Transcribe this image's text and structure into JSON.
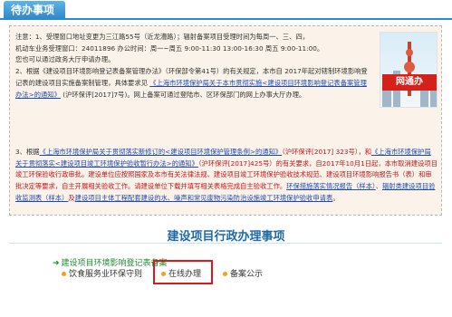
{
  "header": {
    "tab_label": "待办事项"
  },
  "notice": {
    "p1_a": "注意：1、受理窗口地址变更为三江路55号（近龙漕路）；辐射备案项目受理时间为每周一、三、四，",
    "p1_b": "机动车业务受理窗口：24011896 办公时间：周一~周五 9:00-11:30 13:00-16:30 周五 9:00-11:00。",
    "p1_c": "您也可以通过政务大厅申请办理。",
    "p2_a": "2、根据《建设项目环境影响登记表备案管理办法》（环保部令第41号）的有关规定，本市自",
    "p2_b": "2017年起对辖制环境影响登记表的建设项目实施备案制管理，具体要求见",
    "p2_link1": "《上海市环境保护局关于本市贯彻实施<建设项目环境影响登记表备案管理办法>的通知》",
    "p2_c": "(沪环保评[2017]7号)。网上备案可通过登陆市、区环保部门的网上办事大厅办理。",
    "p3_prefix": "3、根据",
    "p3_link1": "《上海市环境保护局关于贯彻落实新修订的<建设项目环境保护管理条例>的通知》",
    "p3_a": "（沪环保评",
    "p3_b": "[2017] 323号）",
    "p3_and": "，和",
    "p3_link2": "《上海市环境保护局关于贯彻落实<建设项目竣工环境保护验收暂行办法>的通知》",
    "p3_c": "（沪环保评[2017]425号）",
    "p3_d": "的有关要求，自2017年10月1日起，本市取消建设项目竣工环保验收行政审批。建设单位应按照国家及本市有关法律法规、建设项目竣工环境保护验收技术规范、建设项目环境影响报告书（表）和审批决定等要求，自主开展相关验收工作。请建设单位下载并填写相关表格完成自主验收工作。",
    "p3_link3": "环保措施落实情况报告（样本）",
    "p3_e": "、",
    "p3_link4": "辐射类建设项目验收监测表（样本）",
    "p3_f": "及",
    "p3_link5": "建设项目主体工程配套建设的水、噪声和常见废物污染防治设施竣工环境保护验收申请表",
    "p3_g": "。"
  },
  "side_image": {
    "label": "网通办"
  },
  "section": {
    "title": "建设项目行政办理事项",
    "category": "建设项目环境影响登记表备案",
    "items": [
      {
        "label": "饮食服务业环保守则"
      },
      {
        "label": "在线办理"
      },
      {
        "label": "备案公示"
      }
    ]
  },
  "colors": {
    "accent": "#2e8bc9",
    "highlight": "#d81a1a",
    "notice_bg": "#fbf3e9"
  }
}
